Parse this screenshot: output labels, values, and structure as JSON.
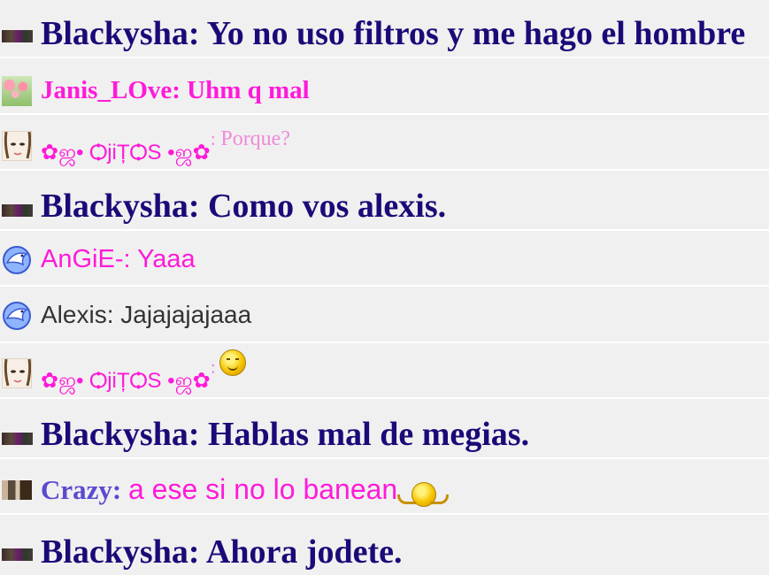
{
  "messages": [
    {
      "name": "Blackysha",
      "sep": ": ",
      "text": "Yo no uso filtros y me hago el hombre",
      "avatar": "blackysha-avatar"
    },
    {
      "name": "Janis_LOve",
      "sep": ": ",
      "text": "Uhm q mal",
      "avatar": "tulips-avatar"
    },
    {
      "name": "✿ஜ• ѺjiȚѺS •ஜ✿",
      "sep": ": ",
      "text": "Porque?",
      "avatar": "drawn-face-avatar"
    },
    {
      "name": "Blackysha",
      "sep": ": ",
      "text": "Como vos alexis.",
      "avatar": "blackysha-avatar"
    },
    {
      "name": "AnGiE-",
      "sep": ": ",
      "text": "Yaaa",
      "avatar": "dolphin-avatar"
    },
    {
      "name": "Alexis",
      "sep": ": ",
      "text": "Jajajajajaaa",
      "avatar": "dolphin-avatar"
    },
    {
      "name": "✿ஜ• ѺjiȚѺS •ஜ✿",
      "sep": ":",
      "text": "",
      "emoticon": "smug-smiley-icon",
      "avatar": "drawn-face-avatar"
    },
    {
      "name": "Blackysha",
      "sep": ": ",
      "text": "Hablas mal de megias.",
      "avatar": "blackysha-avatar"
    },
    {
      "name": "Crazy",
      "sep": ": ",
      "text": "a ese si no lo banean",
      "emoticon": "shrug-smiley-icon",
      "avatar": "crazy-avatar"
    },
    {
      "name": "Blackysha",
      "sep": ": ",
      "text": "Ahora jodete.",
      "avatar": "blackysha-avatar"
    }
  ],
  "colors": {
    "background": "#f0f0f0",
    "blackysha": "#1a0a78",
    "pink": "#ff1ad9",
    "pink_light": "#f08ad8",
    "crazy_name": "#5a4ad0",
    "alexis": "#333333"
  }
}
